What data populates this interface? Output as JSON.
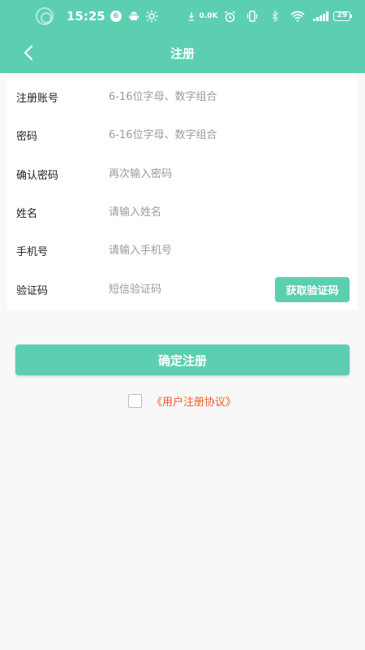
{
  "status_bar": {
    "time": "15:25",
    "notification_badge": "6",
    "net_speed": "0.0K",
    "battery": "29"
  },
  "navbar": {
    "title": "注册"
  },
  "form": {
    "rows": [
      {
        "label": "注册账号",
        "placeholder": "6-16位字母、数字组合"
      },
      {
        "label": "密码",
        "placeholder": "6-16位字母、数字组合"
      },
      {
        "label": "确认密码",
        "placeholder": "再次输入密码"
      },
      {
        "label": "姓名",
        "placeholder": "请输入姓名"
      },
      {
        "label": "手机号",
        "placeholder": "请输入手机号"
      },
      {
        "label": "验证码",
        "placeholder": "短信验证码"
      }
    ],
    "code_button": "获取验证码"
  },
  "submit_label": "确定注册",
  "agreement": {
    "link_text": "《用户注册协议》"
  },
  "colors": {
    "primary": "#5ccfb1",
    "link": "#f05a28",
    "background": "#f8f8f8"
  }
}
